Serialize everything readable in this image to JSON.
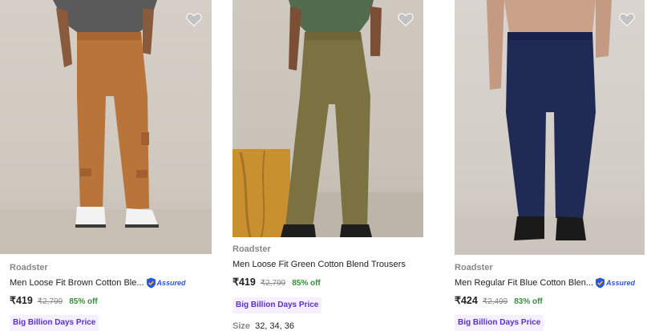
{
  "products": [
    {
      "brand": "Roadster",
      "title": "Men Loose Fit Brown Cotton Ble...",
      "assured": "Assured",
      "price": "₹419",
      "mrp": "₹2,799",
      "discount": "85% off",
      "badge": "Big Billion Days Price",
      "pant_color": "#b9743a",
      "shirt_color": "#5a5a5a"
    },
    {
      "brand": "Roadster",
      "title": "Men Loose Fit Green Cotton Blend Trousers",
      "price": "₹419",
      "mrp": "₹2,799",
      "discount": "85% off",
      "badge": "Big Billion Days Price",
      "size_label": "Size",
      "sizes": "32, 34, 36",
      "pant_color": "#7c7141",
      "shirt_color": "#536c4e"
    },
    {
      "brand": "Roadster",
      "title": "Men Regular Fit Blue Cotton Blen...",
      "assured": "Assured",
      "price": "₹424",
      "mrp": "₹2,499",
      "discount": "83% off",
      "badge": "Big Billion Days Price",
      "pant_color": "#1f2a55"
    }
  ],
  "colors": {
    "discount_green": "#388e3c",
    "badge_purple": "#5b30c8",
    "badge_bg": "#f5f0ff",
    "assured_blue": "#2a55e5",
    "wishlist_heart": "#c2c2c2"
  },
  "icons": {
    "wishlist": "heart-icon",
    "assured": "shield-check-icon"
  }
}
